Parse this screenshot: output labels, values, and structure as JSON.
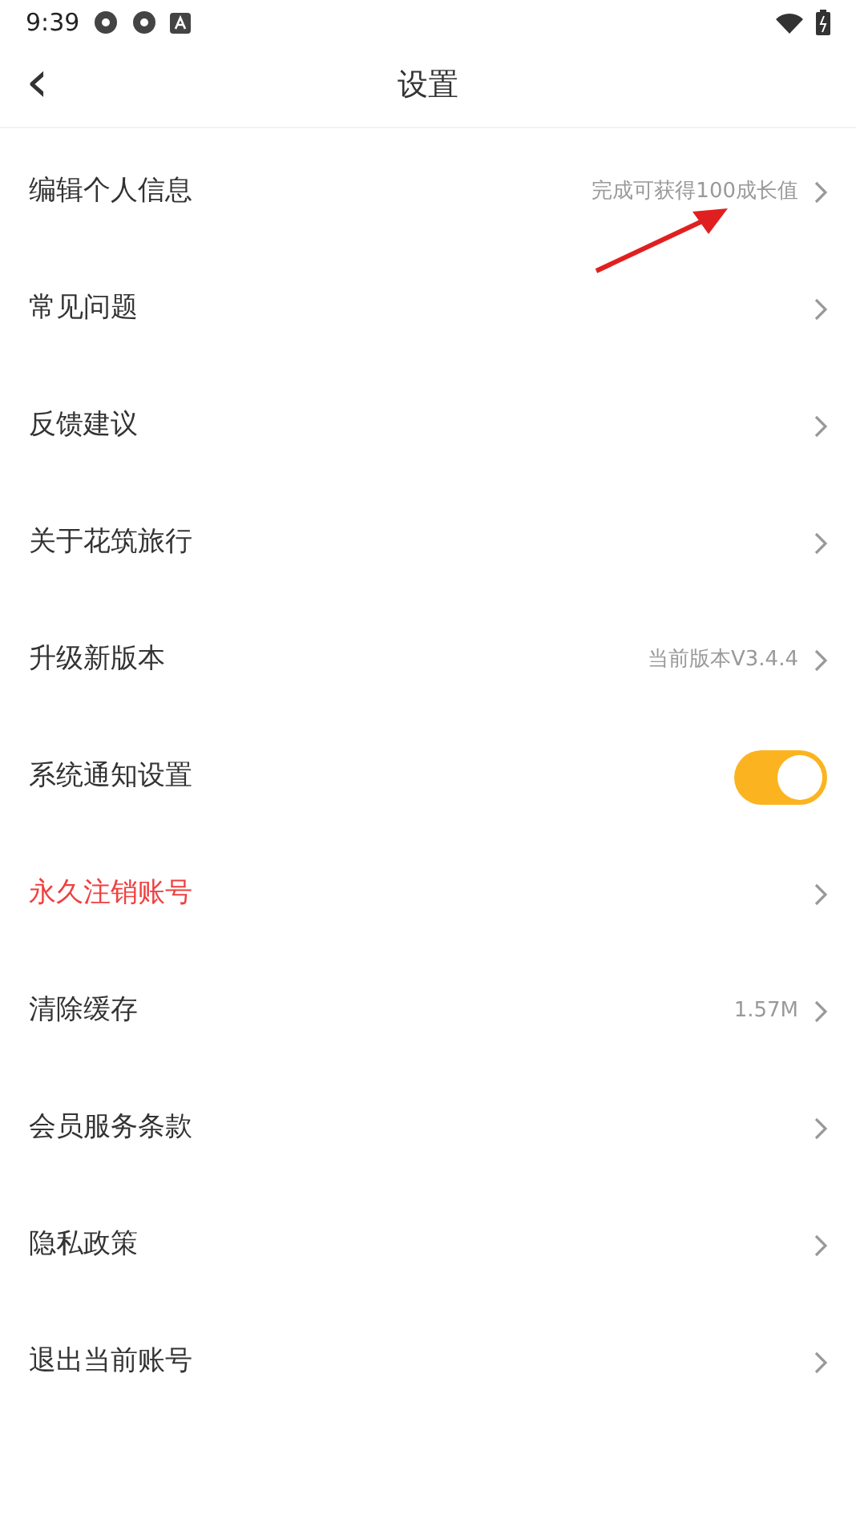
{
  "status_bar": {
    "time": "9:39"
  },
  "header": {
    "back": "‹",
    "title": "设置"
  },
  "items": [
    {
      "kind": "link",
      "label": "编辑个人信息",
      "hint": "完成可获得100成长值",
      "danger": false
    },
    {
      "kind": "link",
      "label": "常见问题",
      "danger": false
    },
    {
      "kind": "link",
      "label": "反馈建议",
      "danger": false
    },
    {
      "kind": "link",
      "label": "关于花筑旅行",
      "danger": false
    },
    {
      "kind": "link",
      "label": "升级新版本",
      "hint": "当前版本V3.4.4",
      "danger": false
    },
    {
      "kind": "toggle",
      "label": "系统通知设置",
      "on": true
    },
    {
      "kind": "link",
      "label": "永久注销账号",
      "danger": true
    },
    {
      "kind": "link",
      "label": "清除缓存",
      "hint": "1.57M",
      "danger": false
    },
    {
      "kind": "link",
      "label": "会员服务条款",
      "danger": false
    },
    {
      "kind": "link",
      "label": "隐私政策",
      "danger": false
    },
    {
      "kind": "link",
      "label": "退出当前账号",
      "danger": false
    }
  ]
}
